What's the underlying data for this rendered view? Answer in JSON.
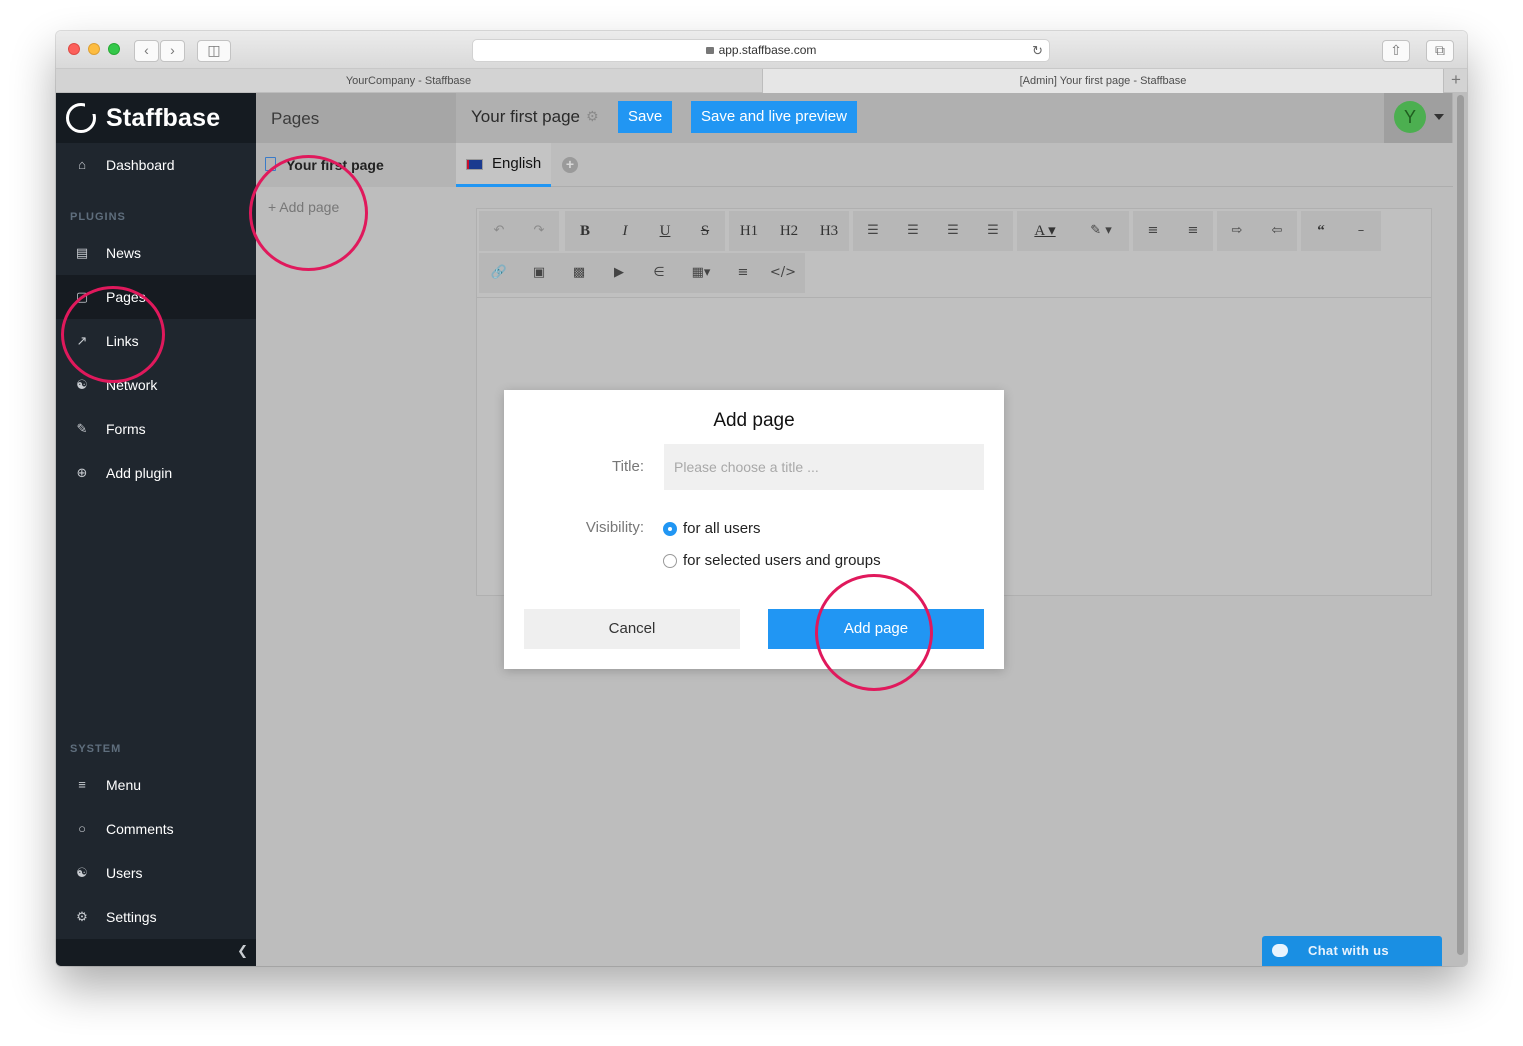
{
  "browser": {
    "url": "app.staffbase.com",
    "tabs": [
      {
        "title": "YourCompany - Staffbase"
      },
      {
        "title": "[Admin] Your first page - Staffbase"
      }
    ],
    "new_tab": "+"
  },
  "brand": {
    "name": "Staffbase"
  },
  "sidebar": {
    "dashboard": "Dashboard",
    "plugins_header": "PLUGINS",
    "plugins": [
      "News",
      "Pages",
      "Links",
      "Network",
      "Forms",
      "Add plugin"
    ],
    "system_header": "SYSTEM",
    "system": [
      "Menu",
      "Comments",
      "Users",
      "Settings"
    ]
  },
  "pages_panel": {
    "header": "Pages",
    "items": [
      "Your first page"
    ],
    "add_page": "+ Add page"
  },
  "topbar": {
    "page_title": "Your first page",
    "save": "Save",
    "save_preview": "Save and live preview",
    "avatar_initial": "Y"
  },
  "language_tab": {
    "label": "English"
  },
  "toolbar": {
    "row1": [
      "undo",
      "redo",
      "B",
      "I",
      "U",
      "S",
      "H1",
      "H2",
      "H3",
      "align-left",
      "align-center",
      "align-right",
      "align-justify",
      "text-color",
      "highlight",
      "bullet-list",
      "numbered-list",
      "indent",
      "outdent",
      "quote",
      "horizontal-rule"
    ],
    "row2": [
      "link",
      "image",
      "video",
      "play",
      "attachment",
      "table",
      "paragraph",
      "code"
    ]
  },
  "modal": {
    "title": "Add page",
    "title_label": "Title:",
    "title_placeholder": "Please choose a title ...",
    "visibility_label": "Visibility:",
    "option_all": "for all users",
    "option_selected": "for selected users and groups",
    "cancel": "Cancel",
    "submit": "Add page"
  },
  "chat": {
    "label": "Chat with us"
  },
  "colors": {
    "accent": "#2196f3",
    "annotation": "#e0195c",
    "sidebar": "#1f262e",
    "avatar": "#4caf50"
  }
}
